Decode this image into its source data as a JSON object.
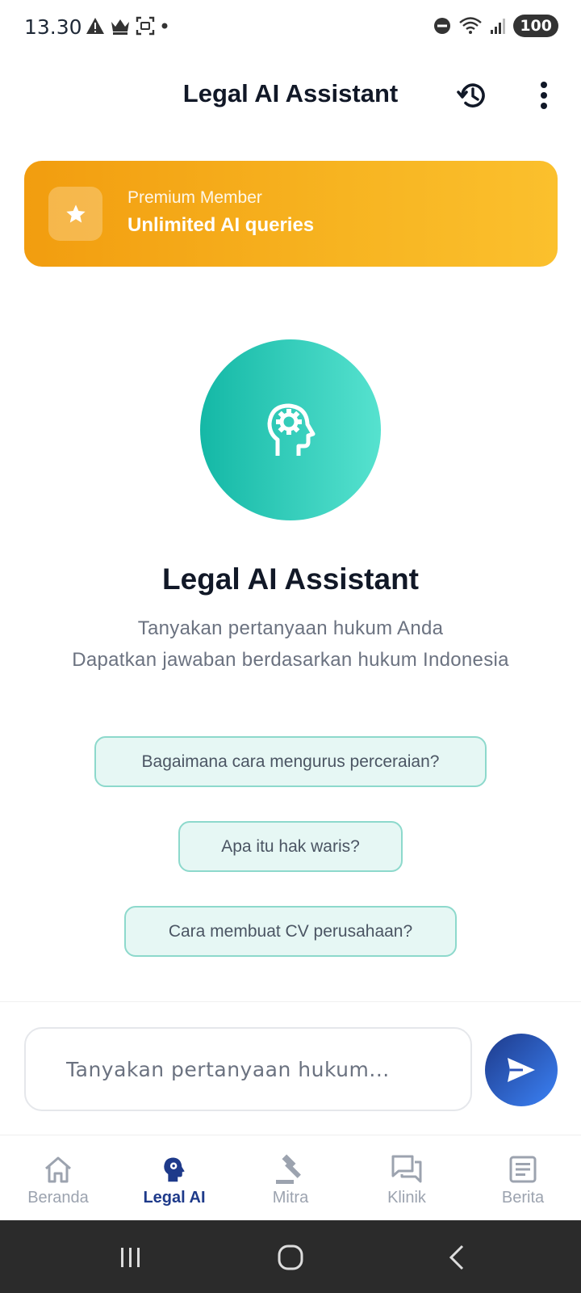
{
  "status_bar": {
    "time": "13.30",
    "battery": "100"
  },
  "header": {
    "title": "Legal AI Assistant"
  },
  "premium": {
    "label": "Premium Member",
    "title": "Unlimited AI queries"
  },
  "hero": {
    "title": "Legal AI Assistant",
    "line1": "Tanyakan pertanyaan hukum Anda",
    "line2": "Dapatkan jawaban berdasarkan hukum Indonesia"
  },
  "suggestions": [
    "Bagaimana cara mengurus perceraian?",
    "Apa itu hak waris?",
    "Cara membuat CV perusahaan?"
  ],
  "input": {
    "placeholder": "Tanyakan pertanyaan hukum...",
    "value": ""
  },
  "nav": {
    "items": [
      {
        "label": "Beranda",
        "icon": "home-icon"
      },
      {
        "label": "Legal AI",
        "icon": "brain-gear-icon",
        "active": true
      },
      {
        "label": "Mitra",
        "icon": "gavel-icon"
      },
      {
        "label": "Klinik",
        "icon": "chat-bubbles-icon"
      },
      {
        "label": "Berita",
        "icon": "article-icon"
      }
    ]
  },
  "colors": {
    "accent_teal": "#14b8a6",
    "premium_orange": "#f29d0f",
    "primary_navy": "#1e3a8a",
    "nav_inactive": "#9ca3af"
  }
}
